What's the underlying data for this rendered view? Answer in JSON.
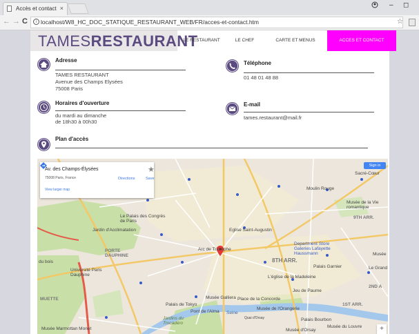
{
  "browser": {
    "tab_title": "Accès et contact",
    "tab_close": "×",
    "url": "localhost/W8_HC_DOC_STATIQUE_RESTAURANT_WEB/FR/acces-et-contact.htm",
    "back": "←",
    "forward": "→",
    "reload": "C",
    "info_glyph": "i",
    "star": "☆",
    "win_user": "👤",
    "win_min": "–",
    "win_max": "◻"
  },
  "header": {
    "logo_part1": "TAMES",
    "logo_part2": "RESTAURANT",
    "nav": [
      {
        "label": "LE RESTAURANT"
      },
      {
        "label": "LE CHEF"
      },
      {
        "label": "CARTE ET MENUS"
      },
      {
        "label": "ACCES ET CONTACT"
      }
    ],
    "active_color": "#ff00ff",
    "brand_color": "#5b4a80"
  },
  "contact": {
    "address": {
      "title": "Adresse",
      "line1": "TAMES RESTAURANT",
      "line2": "Avenue des Champs Elysées",
      "line3": "75008 Paris"
    },
    "phone": {
      "title": "Téléphone",
      "value": "01 48 01 48 88"
    },
    "hours": {
      "title": "Horaires d'ouverture",
      "line1": "du mardi au dimanche",
      "line2": "de 18h30 à 00h30"
    },
    "email": {
      "title": "E-mail",
      "value": "tames.restaurant@mail.fr"
    },
    "plan": {
      "title": "Plan d'accès"
    }
  },
  "map": {
    "card_title": "Av. des Champs-Élysées",
    "card_sub": "75008 Paris, France",
    "card_link": "View larger map",
    "directions": "Directions",
    "save": "Save",
    "sign_in": "Sign in",
    "zoom_in": "+",
    "labels": {
      "sacre_coeur": "Sacré-Cœur",
      "moulin_rouge": "Moulin Rouge",
      "musee_vie": "Musée de la Vie romantique",
      "arr9": "9TH ARR.",
      "arr8": "8TH ARR.",
      "arr1": "1ST ARR.",
      "arr2": "2ND A",
      "eglise_augustin": "Eglise Saint-Augustin",
      "arc": "Arc de Triomphe",
      "palais_congres": "Le Palais des Congrès de Paris",
      "jardin": "Jardin d'Acclimatation",
      "porte_dauphine": "PORTE DAUPHINE",
      "universite": "Université Paris Dauphine",
      "bois": "du bois",
      "muette": "MUETTE",
      "dept_store": "Department Store Galeries Lafayette Haussmann",
      "palais_garnier": "Palais Garnier",
      "grand_rex": "Le Grand",
      "musee": "Musée",
      "madeleine": "L'église de la Madeleine",
      "jeu_paume": "Jeu de Paume",
      "concorde": "Place de la Concorde",
      "orangerie": "Musée de l'Orangerie",
      "galliera": "Musée Galliera",
      "palais_tokyo": "Palais de Tokyo",
      "pont_alma": "Pont de l'Alma",
      "jardins_troca": "Jardins du Trocadéro",
      "marmottan": "Musée Marmottan Monet",
      "bourbon": "Palais Bourbon",
      "louvre": "Musée du Louvre",
      "orsay": "Musée d'Orsay",
      "seine": "Seine",
      "quai": "Quai d'Orsay"
    }
  }
}
